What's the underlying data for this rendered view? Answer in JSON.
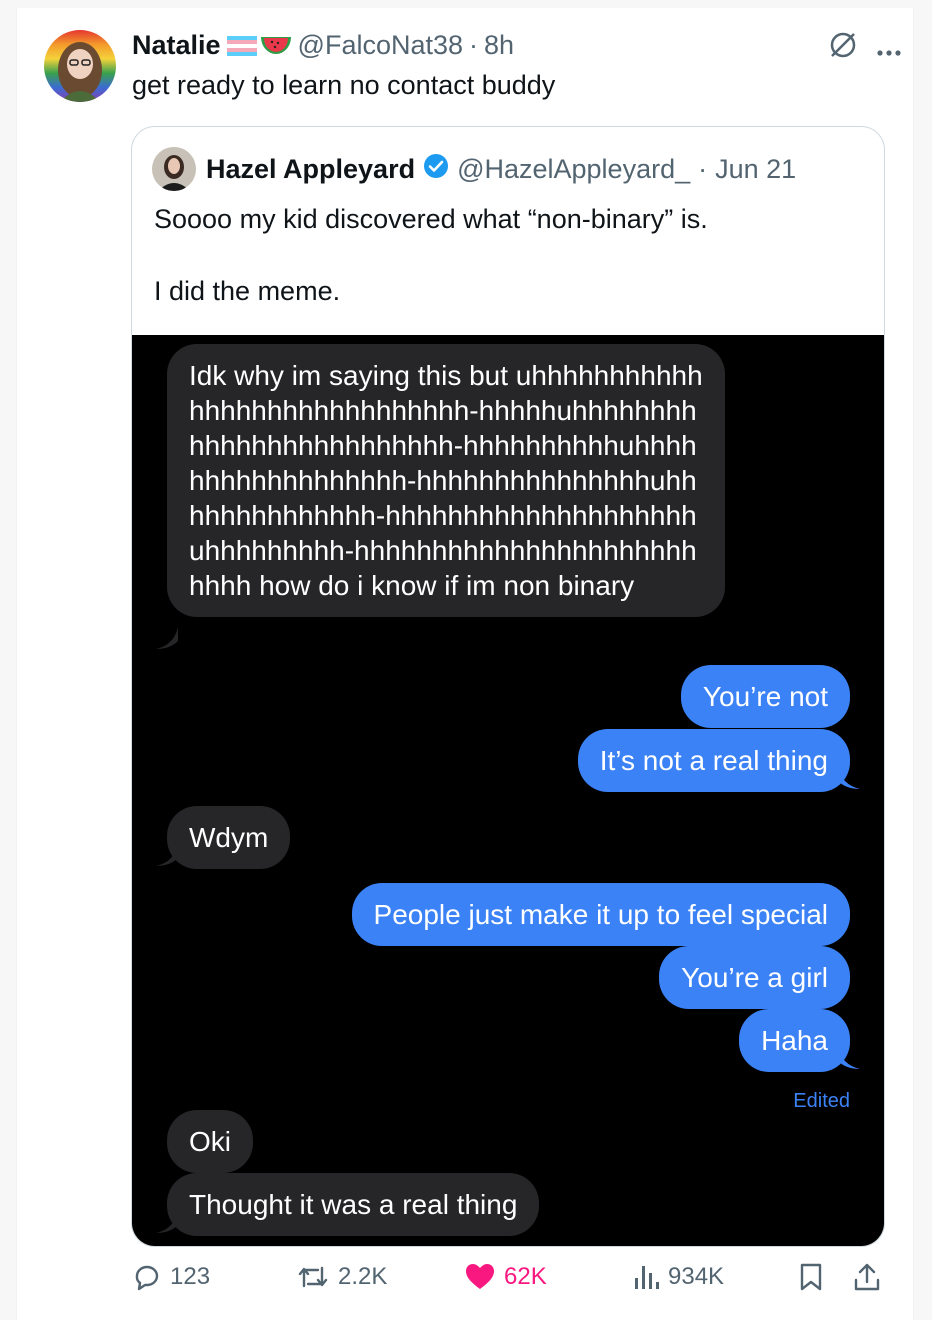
{
  "tweet": {
    "author_name": "Natalie",
    "author_handle": "@FalcoNat38",
    "separator": "·",
    "time": "8h",
    "text": "get ready to learn no contact buddy"
  },
  "quoted": {
    "author_name": "Hazel Appleyard",
    "author_handle": "@HazelAppleyard_",
    "separator": "·",
    "date": "Jun 21",
    "text_line1": "Soooo my kid discovered what “non-binary” is.",
    "text_line2": "I did the meme."
  },
  "messages": {
    "m1": "Idk why im saying this but uhhhhhhhhhhhhhhhhhhhhhhhhhhhhh-hhhhhuhhhhhhhhhhhhhhhhhhhhhhhhh-hhhhhhhhhhuhhhhhhhhhhhhhhhhhh-hhhhhhhhhhhhhhhuhhhhhhhhhhhhhh-hhhhhhhhhhhhhhhhhhhhuhhhhhhhhh-hhhhhhhhhhhhhhhhhhhhhhhhhh how do i know if im non binary",
    "m2": "You’re not",
    "m3": "It’s not a real thing",
    "m4": "Wdym",
    "m5": "People just make it up to feel special",
    "m6": "You’re a girl",
    "m7": "Haha",
    "edited_label": "Edited",
    "m8": "Oki",
    "m9": "Thought it was a real thing"
  },
  "actions": {
    "replies": "123",
    "reposts": "2.2K",
    "likes": "62K",
    "views": "934K"
  },
  "icons": {
    "more": "more-icon",
    "grok": "grok-icon",
    "reply": "reply-icon",
    "repost": "repost-icon",
    "like": "heart-icon",
    "views": "views-icon",
    "bookmark": "bookmark-icon",
    "share": "share-icon",
    "verified": "verified-badge-icon"
  },
  "colors": {
    "accent": "#1d9bf0",
    "bubble_out": "#3b82f6",
    "bubble_in": "#262628",
    "like": "#f91880"
  }
}
